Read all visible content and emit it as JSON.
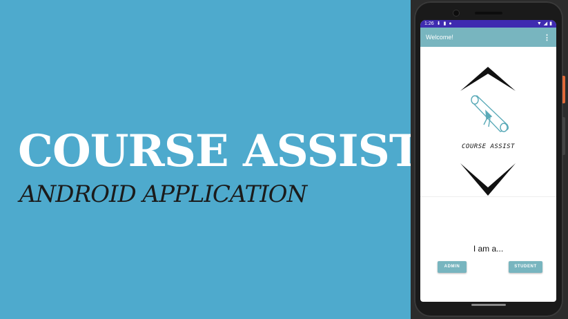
{
  "hero": {
    "title": "COURSE ASSIST",
    "subtitle": "ANDROID APPLICATION"
  },
  "phone": {
    "status": {
      "time": "1:26",
      "icons_left": [
        "download-icon",
        "clipboard-icon",
        "circle-icon"
      ],
      "icons_right": [
        "wifi-icon",
        "signal-icon",
        "battery-icon"
      ]
    },
    "appbar": {
      "title": "Welcome!",
      "menu": "⋮"
    },
    "logo_text": "COURSE ASSIST",
    "prompt": "I am a...",
    "buttons": {
      "admin": "ADMIN",
      "student": "STUDENT"
    }
  },
  "colors": {
    "hero_bg": "#4eaacd",
    "status_bar": "#3f2bb0",
    "app_bar": "#78b5bf",
    "button": "#78b5bf",
    "title_text": "#ffffff"
  }
}
